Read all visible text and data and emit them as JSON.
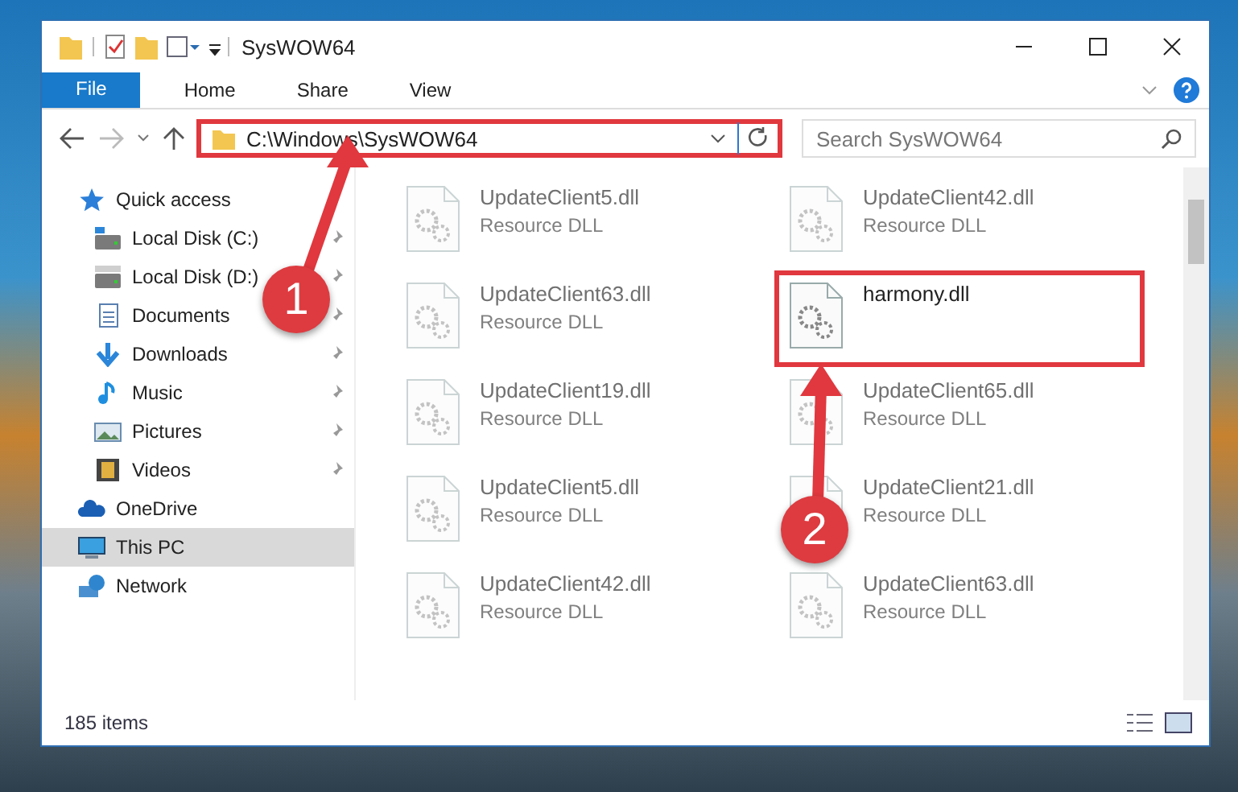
{
  "window": {
    "title": "SysWOW64"
  },
  "ribbon_tabs": [
    {
      "label": "File",
      "kind": "file"
    },
    {
      "label": "Home",
      "kind": "tab"
    },
    {
      "label": "Share",
      "kind": "tab"
    },
    {
      "label": "View",
      "kind": "tab"
    }
  ],
  "address_bar": {
    "path": "C:\\Windows\\SysWOW64",
    "highlighted": true
  },
  "search": {
    "placeholder": "Search SysWOW64"
  },
  "sidebar": {
    "items": [
      {
        "label": "Quick access",
        "kind": "star",
        "selected": false,
        "children": [
          {
            "label": "Local Disk (C:)",
            "kind": "drive-c",
            "pinned": true
          },
          {
            "label": "Local Disk (D:)",
            "kind": "drive",
            "pinned": true
          },
          {
            "label": "Documents",
            "kind": "documents",
            "pinned": true
          },
          {
            "label": "Downloads",
            "kind": "downloads",
            "pinned": true
          },
          {
            "label": "Music",
            "kind": "music",
            "pinned": true
          },
          {
            "label": "Pictures",
            "kind": "pictures",
            "pinned": true
          },
          {
            "label": "Videos",
            "kind": "videos",
            "pinned": true
          }
        ]
      },
      {
        "label": "OneDrive",
        "kind": "cloud",
        "selected": false
      },
      {
        "label": "This PC",
        "kind": "pc",
        "selected": true
      },
      {
        "label": "Network",
        "kind": "network",
        "selected": false
      }
    ]
  },
  "files": [
    {
      "name": "UpdateClient5.dll",
      "type": "Resource DLL",
      "blurred": true,
      "highlighted": false
    },
    {
      "name": "UpdateClient42.dll",
      "type": "Resource DLL",
      "blurred": true,
      "highlighted": false
    },
    {
      "name": "UpdateClient63.dll",
      "type": "Resource DLL",
      "blurred": true,
      "highlighted": false
    },
    {
      "name": "harmony.dll",
      "blurred": false,
      "highlighted": true
    },
    {
      "name": "UpdateClient19.dll",
      "type": "Resource DLL",
      "blurred": true,
      "highlighted": false
    },
    {
      "name": "UpdateClient65.dll",
      "type": "Resource DLL",
      "blurred": true,
      "highlighted": false
    },
    {
      "name": "UpdateClient5.dll",
      "type": "Resource DLL",
      "blurred": true,
      "highlighted": false
    },
    {
      "name": "UpdateClient21.dll",
      "type": "Resource DLL",
      "blurred": true,
      "highlighted": false
    },
    {
      "name": "UpdateClient42.dll",
      "type": "Resource DLL",
      "blurred": true,
      "highlighted": false
    },
    {
      "name": "UpdateClient63.dll",
      "type": "Resource DLL",
      "blurred": true,
      "highlighted": false
    }
  ],
  "status_bar": {
    "item_count": "185 items"
  },
  "annotations": [
    {
      "number": "1"
    },
    {
      "number": "2"
    }
  ]
}
